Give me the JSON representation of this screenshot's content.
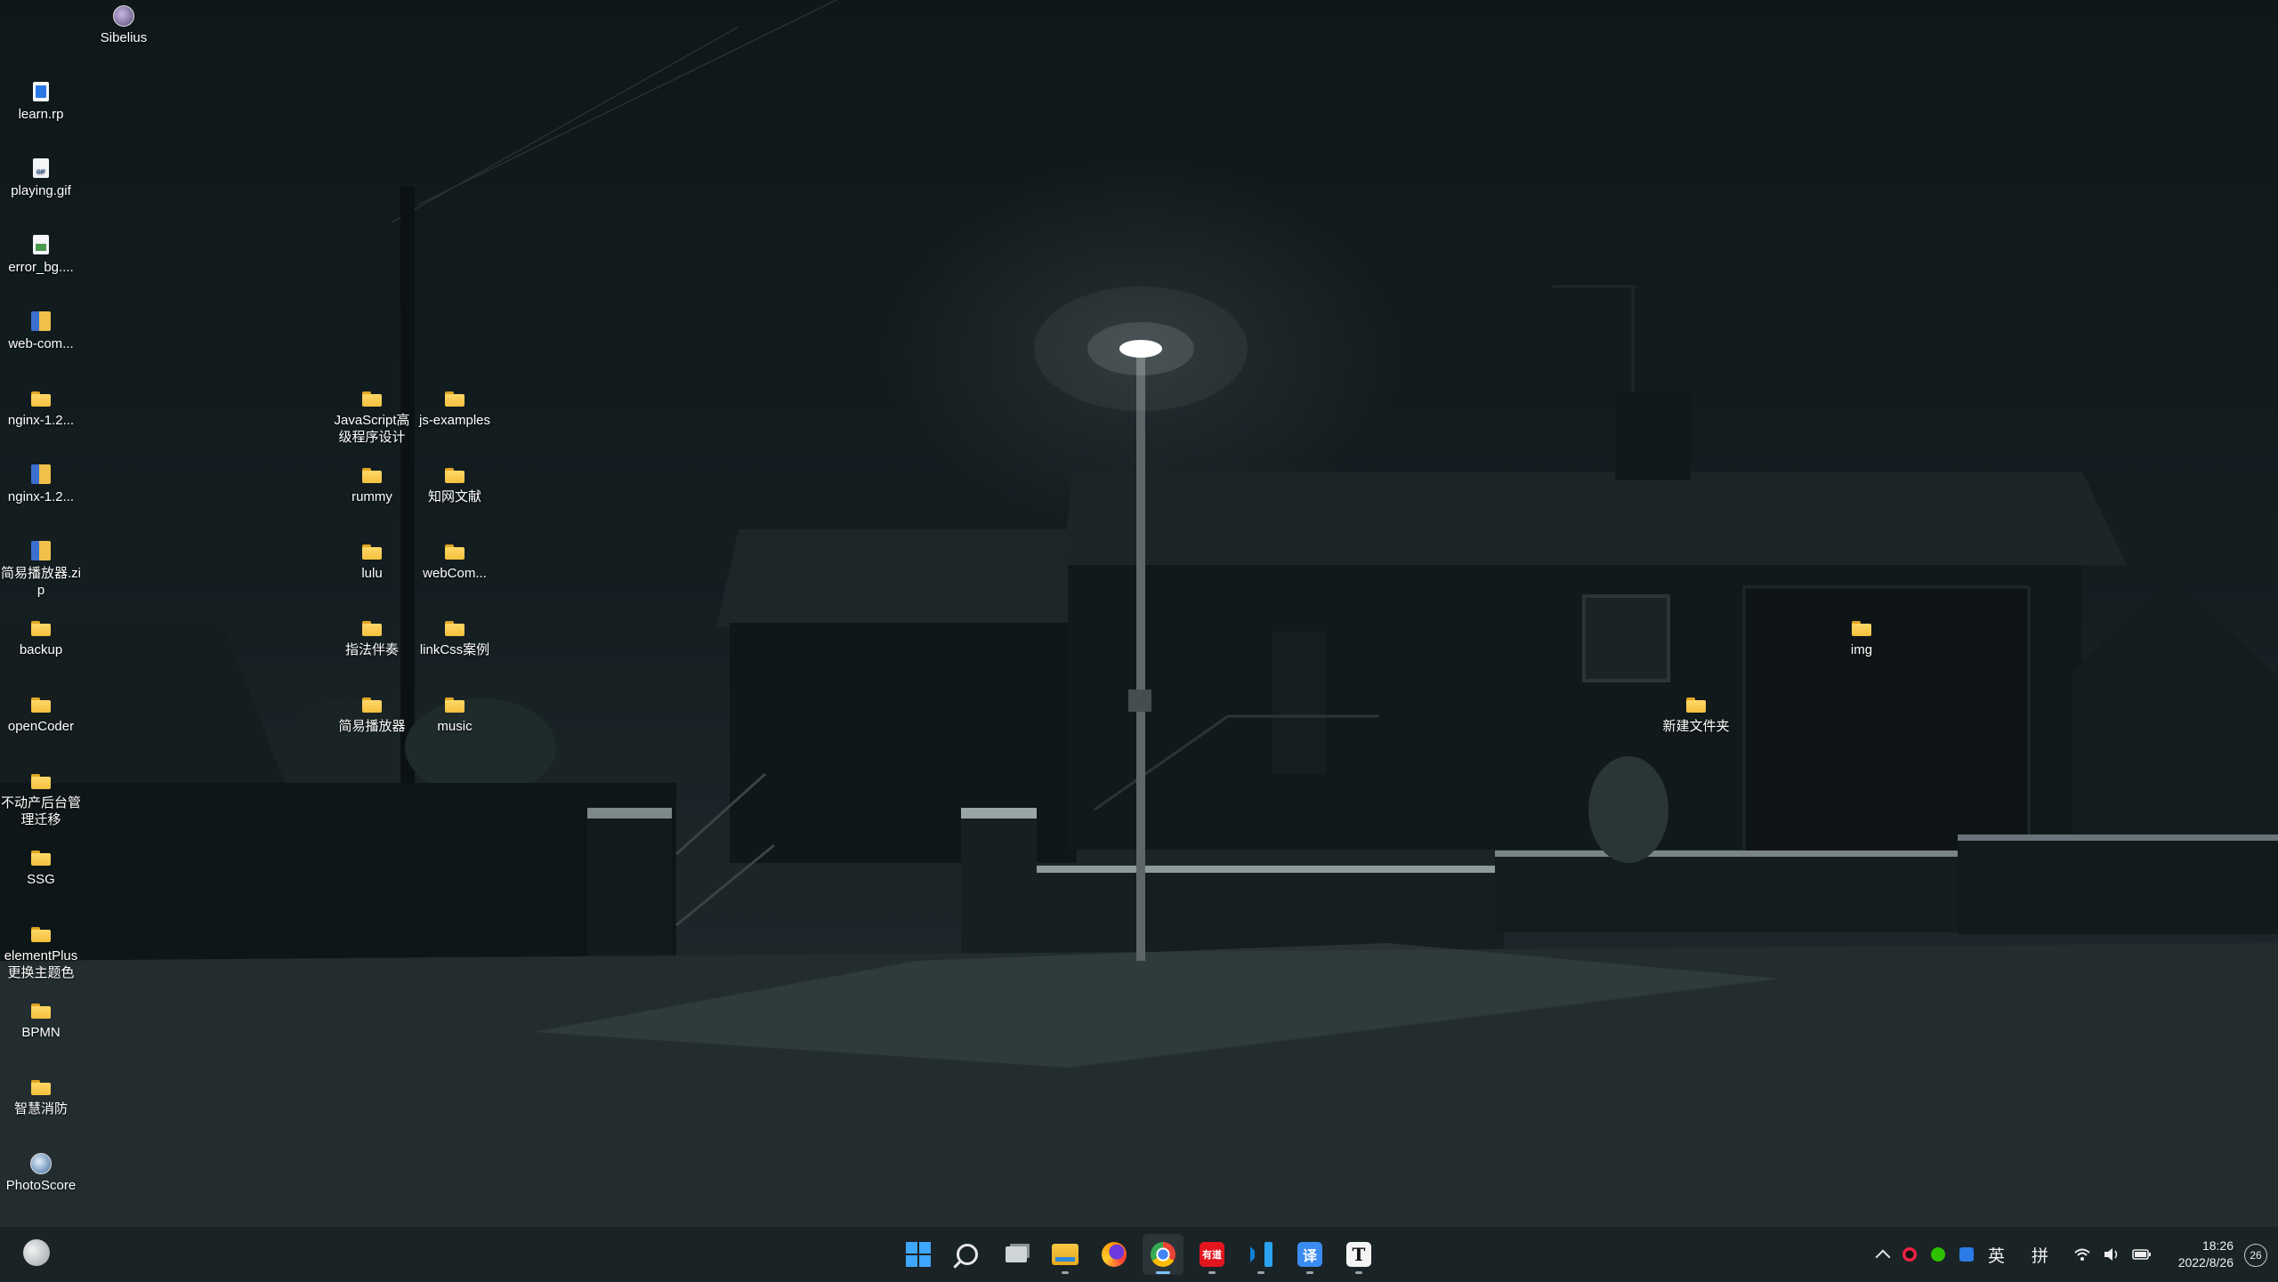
{
  "desktop": {
    "icons": [
      {
        "key": "sibelius",
        "label": "Sibelius",
        "type": "app"
      },
      {
        "key": "learn-rp",
        "label": "learn.rp",
        "type": "doc-blue"
      },
      {
        "key": "playing-gif",
        "label": "playing.gif",
        "type": "doc-gif"
      },
      {
        "key": "error-bg",
        "label": "error_bg....",
        "type": "doc-img"
      },
      {
        "key": "web-com-zip",
        "label": "web-com...",
        "type": "zip"
      },
      {
        "key": "nginx-1",
        "label": "nginx-1.2...",
        "type": "folder"
      },
      {
        "key": "nginx-2",
        "label": "nginx-1.2...",
        "type": "zip"
      },
      {
        "key": "jianyi-zip",
        "label": "简易播放器.zip",
        "type": "zip"
      },
      {
        "key": "backup",
        "label": "backup",
        "type": "folder"
      },
      {
        "key": "opencoder",
        "label": "openCoder",
        "type": "folder"
      },
      {
        "key": "budongchan",
        "label": "不动产后台管理迁移",
        "type": "folder"
      },
      {
        "key": "ssg",
        "label": "SSG",
        "type": "folder"
      },
      {
        "key": "elementplus",
        "label": "elementPlus更换主题色",
        "type": "folder"
      },
      {
        "key": "bpmn",
        "label": "BPMN",
        "type": "folder"
      },
      {
        "key": "zhihui",
        "label": "智慧消防",
        "type": "folder"
      },
      {
        "key": "photoscore",
        "label": "PhotoScore",
        "type": "app-photo"
      },
      {
        "key": "javascript",
        "label": "JavaScript高级程序设计",
        "type": "folder"
      },
      {
        "key": "js-examples",
        "label": "js-examples",
        "type": "folder"
      },
      {
        "key": "rummy",
        "label": "rummy",
        "type": "folder"
      },
      {
        "key": "zhiwang",
        "label": "知网文献",
        "type": "folder"
      },
      {
        "key": "lulu",
        "label": "lulu",
        "type": "folder"
      },
      {
        "key": "webcom-folder",
        "label": "webCom...",
        "type": "folder"
      },
      {
        "key": "zhifa",
        "label": "指法伴奏",
        "type": "folder"
      },
      {
        "key": "linkcss",
        "label": "linkCss案例",
        "type": "folder"
      },
      {
        "key": "jianyi-folder",
        "label": "简易播放器",
        "type": "folder"
      },
      {
        "key": "music",
        "label": "music",
        "type": "folder"
      },
      {
        "key": "img",
        "label": "img",
        "type": "folder"
      },
      {
        "key": "new-folder",
        "label": "新建文件夹",
        "type": "folder"
      }
    ]
  },
  "taskbar": {
    "apps": [
      {
        "key": "start",
        "icon": "windows-start-icon"
      },
      {
        "key": "search",
        "icon": "search-icon"
      },
      {
        "key": "task-view",
        "icon": "task-view-icon"
      },
      {
        "key": "file-explorer",
        "icon": "file-explorer-icon"
      },
      {
        "key": "firefox",
        "icon": "firefox-icon"
      },
      {
        "key": "chrome",
        "icon": "chrome-icon"
      },
      {
        "key": "youdao",
        "icon": "youdao-icon",
        "text": "有道"
      },
      {
        "key": "vscode",
        "icon": "vscode-icon"
      },
      {
        "key": "translate",
        "icon": "translate-icon",
        "text": "译"
      },
      {
        "key": "typora",
        "icon": "typora-icon",
        "text": "T"
      }
    ],
    "tray": {
      "ime_lang": "英",
      "ime_mode": "拼"
    },
    "clock": {
      "time": "18:26",
      "date": "2022/8/26"
    },
    "notification_count": "26"
  },
  "colors": {
    "accent": "#3fa6ff",
    "folder": "#f3c03e",
    "taskbar_bg": "#1a2326"
  }
}
